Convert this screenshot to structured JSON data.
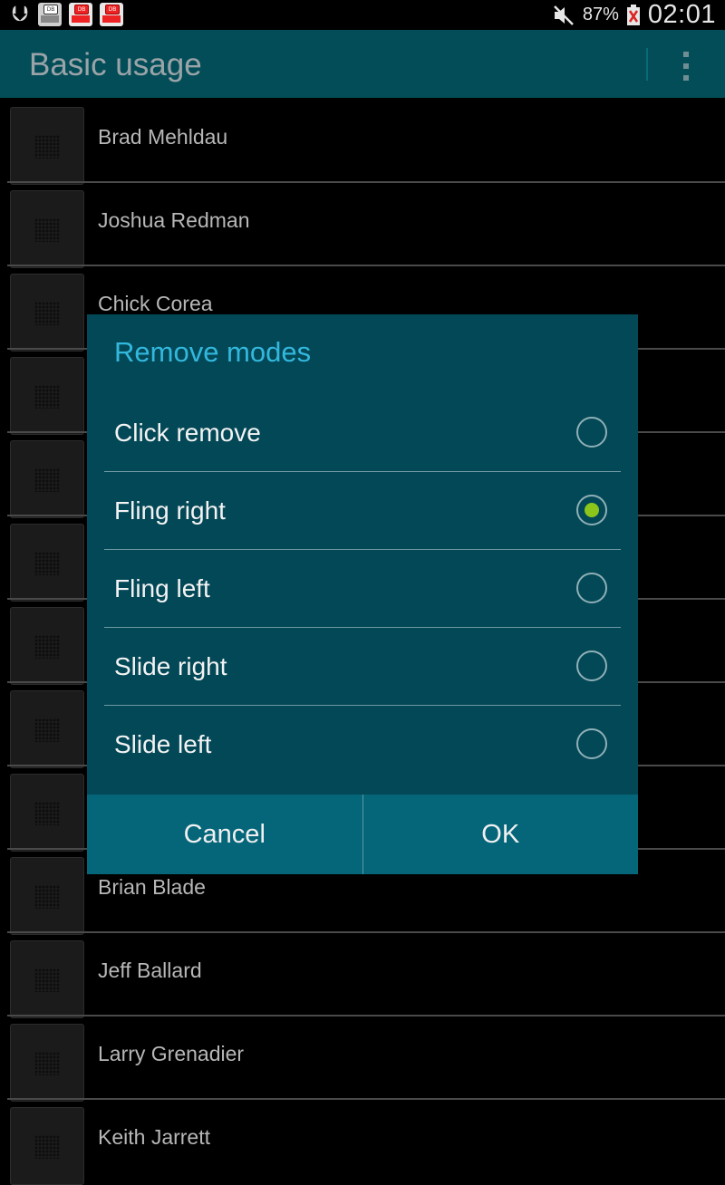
{
  "status_bar": {
    "battery_percent": "87%",
    "time": "02:01",
    "left_icons": [
      "usb-icon",
      "app-notification-icon",
      "app-notification-icon",
      "app-notification-icon"
    ],
    "right_icons": [
      "mute-icon",
      "battery-icon"
    ]
  },
  "action_bar": {
    "title": "Basic usage",
    "overflow_icon": "overflow-menu-icon"
  },
  "list": {
    "items": [
      "Brad Mehldau",
      "Joshua Redman",
      "Chick Corea",
      "",
      "",
      "",
      "",
      "",
      "",
      "Brian Blade",
      "Jeff Ballard",
      "Larry Grenadier",
      "Keith Jarrett"
    ]
  },
  "dialog": {
    "title": "Remove modes",
    "options": [
      {
        "label": "Click remove",
        "selected": false
      },
      {
        "label": "Fling right",
        "selected": true
      },
      {
        "label": "Fling left",
        "selected": false
      },
      {
        "label": "Slide right",
        "selected": false
      },
      {
        "label": "Slide left",
        "selected": false
      }
    ],
    "cancel_label": "Cancel",
    "ok_label": "OK",
    "accent_color": "#33b8dd",
    "selected_color": "#8cc61a"
  }
}
